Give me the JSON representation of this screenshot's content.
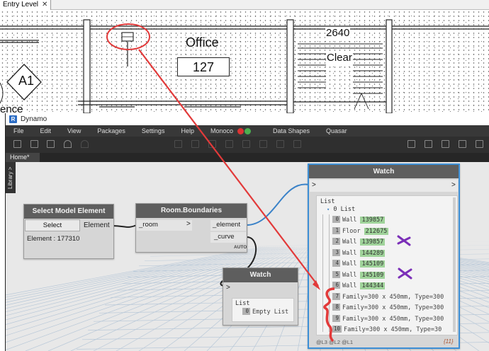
{
  "revit": {
    "view_tab": "Entry Level",
    "close_glyph": "✕",
    "tag_A1": "A1",
    "office_label": "Office",
    "office_number": "127",
    "room_2640": "2640",
    "clear_label": "Clear",
    "ence_fragment": "ence"
  },
  "dynamo": {
    "title": "Dynamo",
    "logo": "R",
    "menu": [
      "File",
      "Edit",
      "View",
      "Packages",
      "Settings",
      "Help",
      "Monoco",
      "Data Shapes",
      "Quasar"
    ],
    "status_colors": [
      "#d33",
      "#4caf50"
    ],
    "tab": "Home*",
    "library_label": "Library >"
  },
  "nodes": {
    "select": {
      "title": "Select Model Element",
      "button": "Select",
      "output": "Element",
      "status": "Element : 177310"
    },
    "boundaries": {
      "title": "Room.Boundaries",
      "input": "_room",
      "input_arrow": ">",
      "outputs": [
        "_element",
        "_curve"
      ],
      "lacing": "AUTO"
    },
    "watch_small": {
      "title": "Watch",
      "arrow": ">",
      "list_label": "List",
      "empty_index": "0",
      "empty_text": "Empty List"
    },
    "watch_big": {
      "title": "Watch",
      "arrow": ">",
      "list_label": "List",
      "sub_index": "0",
      "sub_label": "List",
      "rows": [
        {
          "i": "0",
          "type": "Wall",
          "id": "139857"
        },
        {
          "i": "1",
          "type": "Floor",
          "id": "212675"
        },
        {
          "i": "2",
          "type": "Wall",
          "id": "139857"
        },
        {
          "i": "3",
          "type": "Wall",
          "id": "144289"
        },
        {
          "i": "4",
          "type": "Wall",
          "id": "145109"
        },
        {
          "i": "5",
          "type": "Wall",
          "id": "145109"
        },
        {
          "i": "6",
          "type": "Wall",
          "id": "144344"
        },
        {
          "i": "7",
          "text": "Family=300 x 450mm, Type=300"
        },
        {
          "i": "8",
          "text": "Family=300 x 450mm, Type=300"
        },
        {
          "i": "9",
          "text": "Family=300 x 450mm, Type=300"
        },
        {
          "i": "10",
          "text": "Family=300 x 450mm, Type=30"
        }
      ],
      "footer": "@L3 @L2 @L1",
      "count": "{11}"
    }
  },
  "colors": {
    "annotation_red": "#e23a3a",
    "annotation_purple": "#7b2fb8",
    "wire_blue": "#3a82c8",
    "watch_border": "#3d8fd6"
  }
}
